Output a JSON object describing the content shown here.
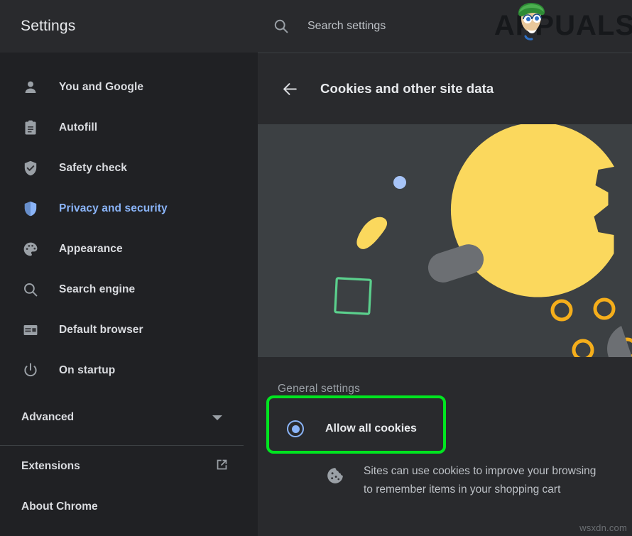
{
  "sidebar": {
    "title": "Settings",
    "items": [
      {
        "label": "You and Google",
        "icon": "person-icon",
        "active": false
      },
      {
        "label": "Autofill",
        "icon": "clipboard-icon",
        "active": false
      },
      {
        "label": "Safety check",
        "icon": "shield-check-icon",
        "active": false
      },
      {
        "label": "Privacy and security",
        "icon": "shield-half-icon",
        "active": true
      },
      {
        "label": "Appearance",
        "icon": "palette-icon",
        "active": false
      },
      {
        "label": "Search engine",
        "icon": "search-icon",
        "active": false
      },
      {
        "label": "Default browser",
        "icon": "browser-window-icon",
        "active": false
      },
      {
        "label": "On startup",
        "icon": "power-icon",
        "active": false
      }
    ],
    "advanced": {
      "label": "Advanced",
      "icon": "chevron-down-icon"
    },
    "footer": [
      {
        "label": "Extensions",
        "icon": "external-link-icon"
      },
      {
        "label": "About Chrome",
        "icon": ""
      }
    ]
  },
  "search": {
    "placeholder": "Search settings",
    "value": "",
    "icon": "search-icon"
  },
  "brand": {
    "text": "APPUALS",
    "face_icon": "appuals-mascot-icon"
  },
  "page": {
    "back_icon": "arrow-left-icon",
    "title": "Cookies and other site data"
  },
  "banner": {
    "icon": "cookie-illustration",
    "background": "#3C4043",
    "cookie_color": "#FBD85D",
    "chip_color": "#F5AE1B",
    "crumb_color": "#FBD85D",
    "dot_color": "#A7C4F7",
    "pill_color": "#6C6F73",
    "square_color": "#5BD08D"
  },
  "settings": {
    "section_title": "General settings",
    "option": {
      "label": "Allow all cookies",
      "selected": true,
      "radio_color": "#8AB4F8",
      "highlight_color": "#00E520"
    },
    "description": {
      "icon": "cookie-icon",
      "line1": "Sites can use cookies to improve your browsing",
      "line2": "to remember items in your shopping cart"
    }
  },
  "watermark": {
    "text": "wsxdn.com"
  }
}
